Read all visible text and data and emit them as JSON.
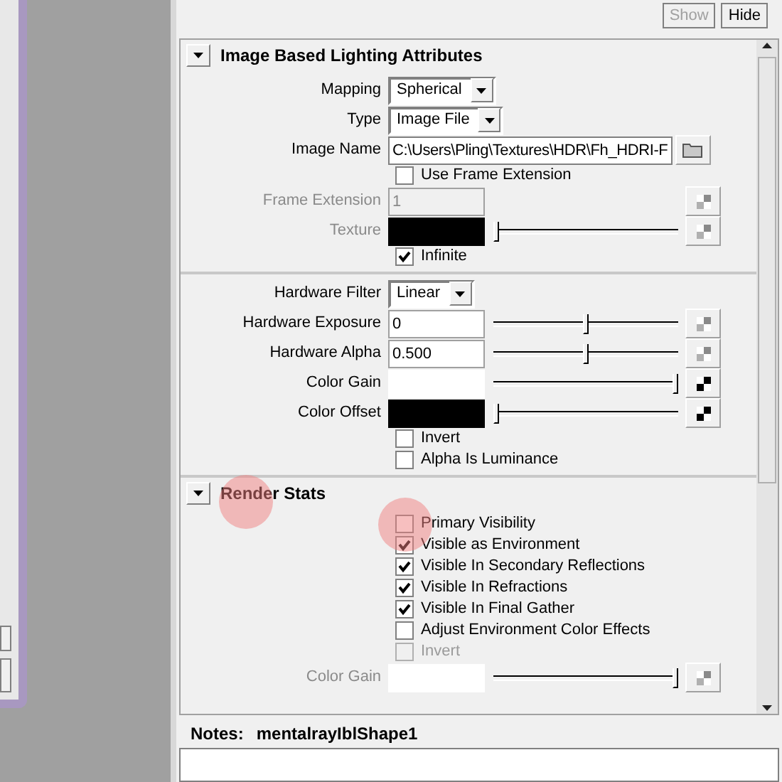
{
  "top_buttons": [
    {
      "label": "Show",
      "disabled": true
    },
    {
      "label": "Hide",
      "disabled": false
    }
  ],
  "sections": [
    {
      "title": "Image Based Lighting Attributes",
      "expanded": true,
      "groups": [
        [
          {
            "kind": "dropdown",
            "label": "Mapping",
            "value": "Spherical"
          },
          {
            "kind": "dropdown",
            "label": "Type",
            "value": "Image File"
          },
          {
            "kind": "path",
            "label": "Image Name",
            "value": "C:\\Users\\Pling\\Textures\\HDR\\Fh_HDRI-F"
          },
          {
            "kind": "checkbox",
            "label": "Use Frame Extension",
            "checked": false,
            "disabled": false
          },
          {
            "kind": "number",
            "label": "Frame Extension",
            "value": "1",
            "disabled": true
          },
          {
            "kind": "color",
            "label": "Texture",
            "color": "#000000",
            "level": 0,
            "disabled": true
          },
          {
            "kind": "checkbox",
            "label": "Infinite",
            "checked": true,
            "disabled": false
          }
        ],
        [
          {
            "kind": "dropdown",
            "label": "Hardware Filter",
            "value": "Linear"
          },
          {
            "kind": "slider",
            "label": "Hardware Exposure",
            "value": "0",
            "level": 0.5,
            "disabled": false
          },
          {
            "kind": "slider",
            "label": "Hardware Alpha",
            "value": "0.500",
            "level": 0.5,
            "disabled": false
          },
          {
            "kind": "color",
            "label": "Color Gain",
            "color": "#ffffff",
            "level": 1,
            "disabled": false
          },
          {
            "kind": "color",
            "label": "Color Offset",
            "color": "#000000",
            "level": 0,
            "disabled": false
          },
          {
            "kind": "checkbox",
            "label": "Invert",
            "checked": false,
            "disabled": false
          },
          {
            "kind": "checkbox",
            "label": "Alpha Is Luminance",
            "checked": false,
            "disabled": false
          }
        ]
      ]
    },
    {
      "title": "Render Stats",
      "expanded": true,
      "groups": [
        [
          {
            "kind": "checkbox",
            "label": "Primary Visibility",
            "checked": false,
            "disabled": false
          },
          {
            "kind": "checkbox",
            "label": "Visible as Environment",
            "checked": true,
            "disabled": false
          },
          {
            "kind": "checkbox",
            "label": "Visible In Secondary Reflections",
            "checked": true,
            "disabled": false
          },
          {
            "kind": "checkbox",
            "label": "Visible In Refractions",
            "checked": true,
            "disabled": false
          },
          {
            "kind": "checkbox",
            "label": "Visible In Final Gather",
            "checked": true,
            "disabled": false
          },
          {
            "kind": "checkbox",
            "label": "Adjust Environment Color Effects",
            "checked": false,
            "disabled": false
          },
          {
            "kind": "checkbox",
            "label": "Invert",
            "checked": false,
            "disabled": true
          },
          {
            "kind": "color",
            "label": "Color Gain",
            "color": "#ffffff",
            "level": 1,
            "disabled": true
          }
        ]
      ]
    }
  ],
  "notes": {
    "label": "Notes:",
    "node": "mentalrayIblShape1"
  }
}
